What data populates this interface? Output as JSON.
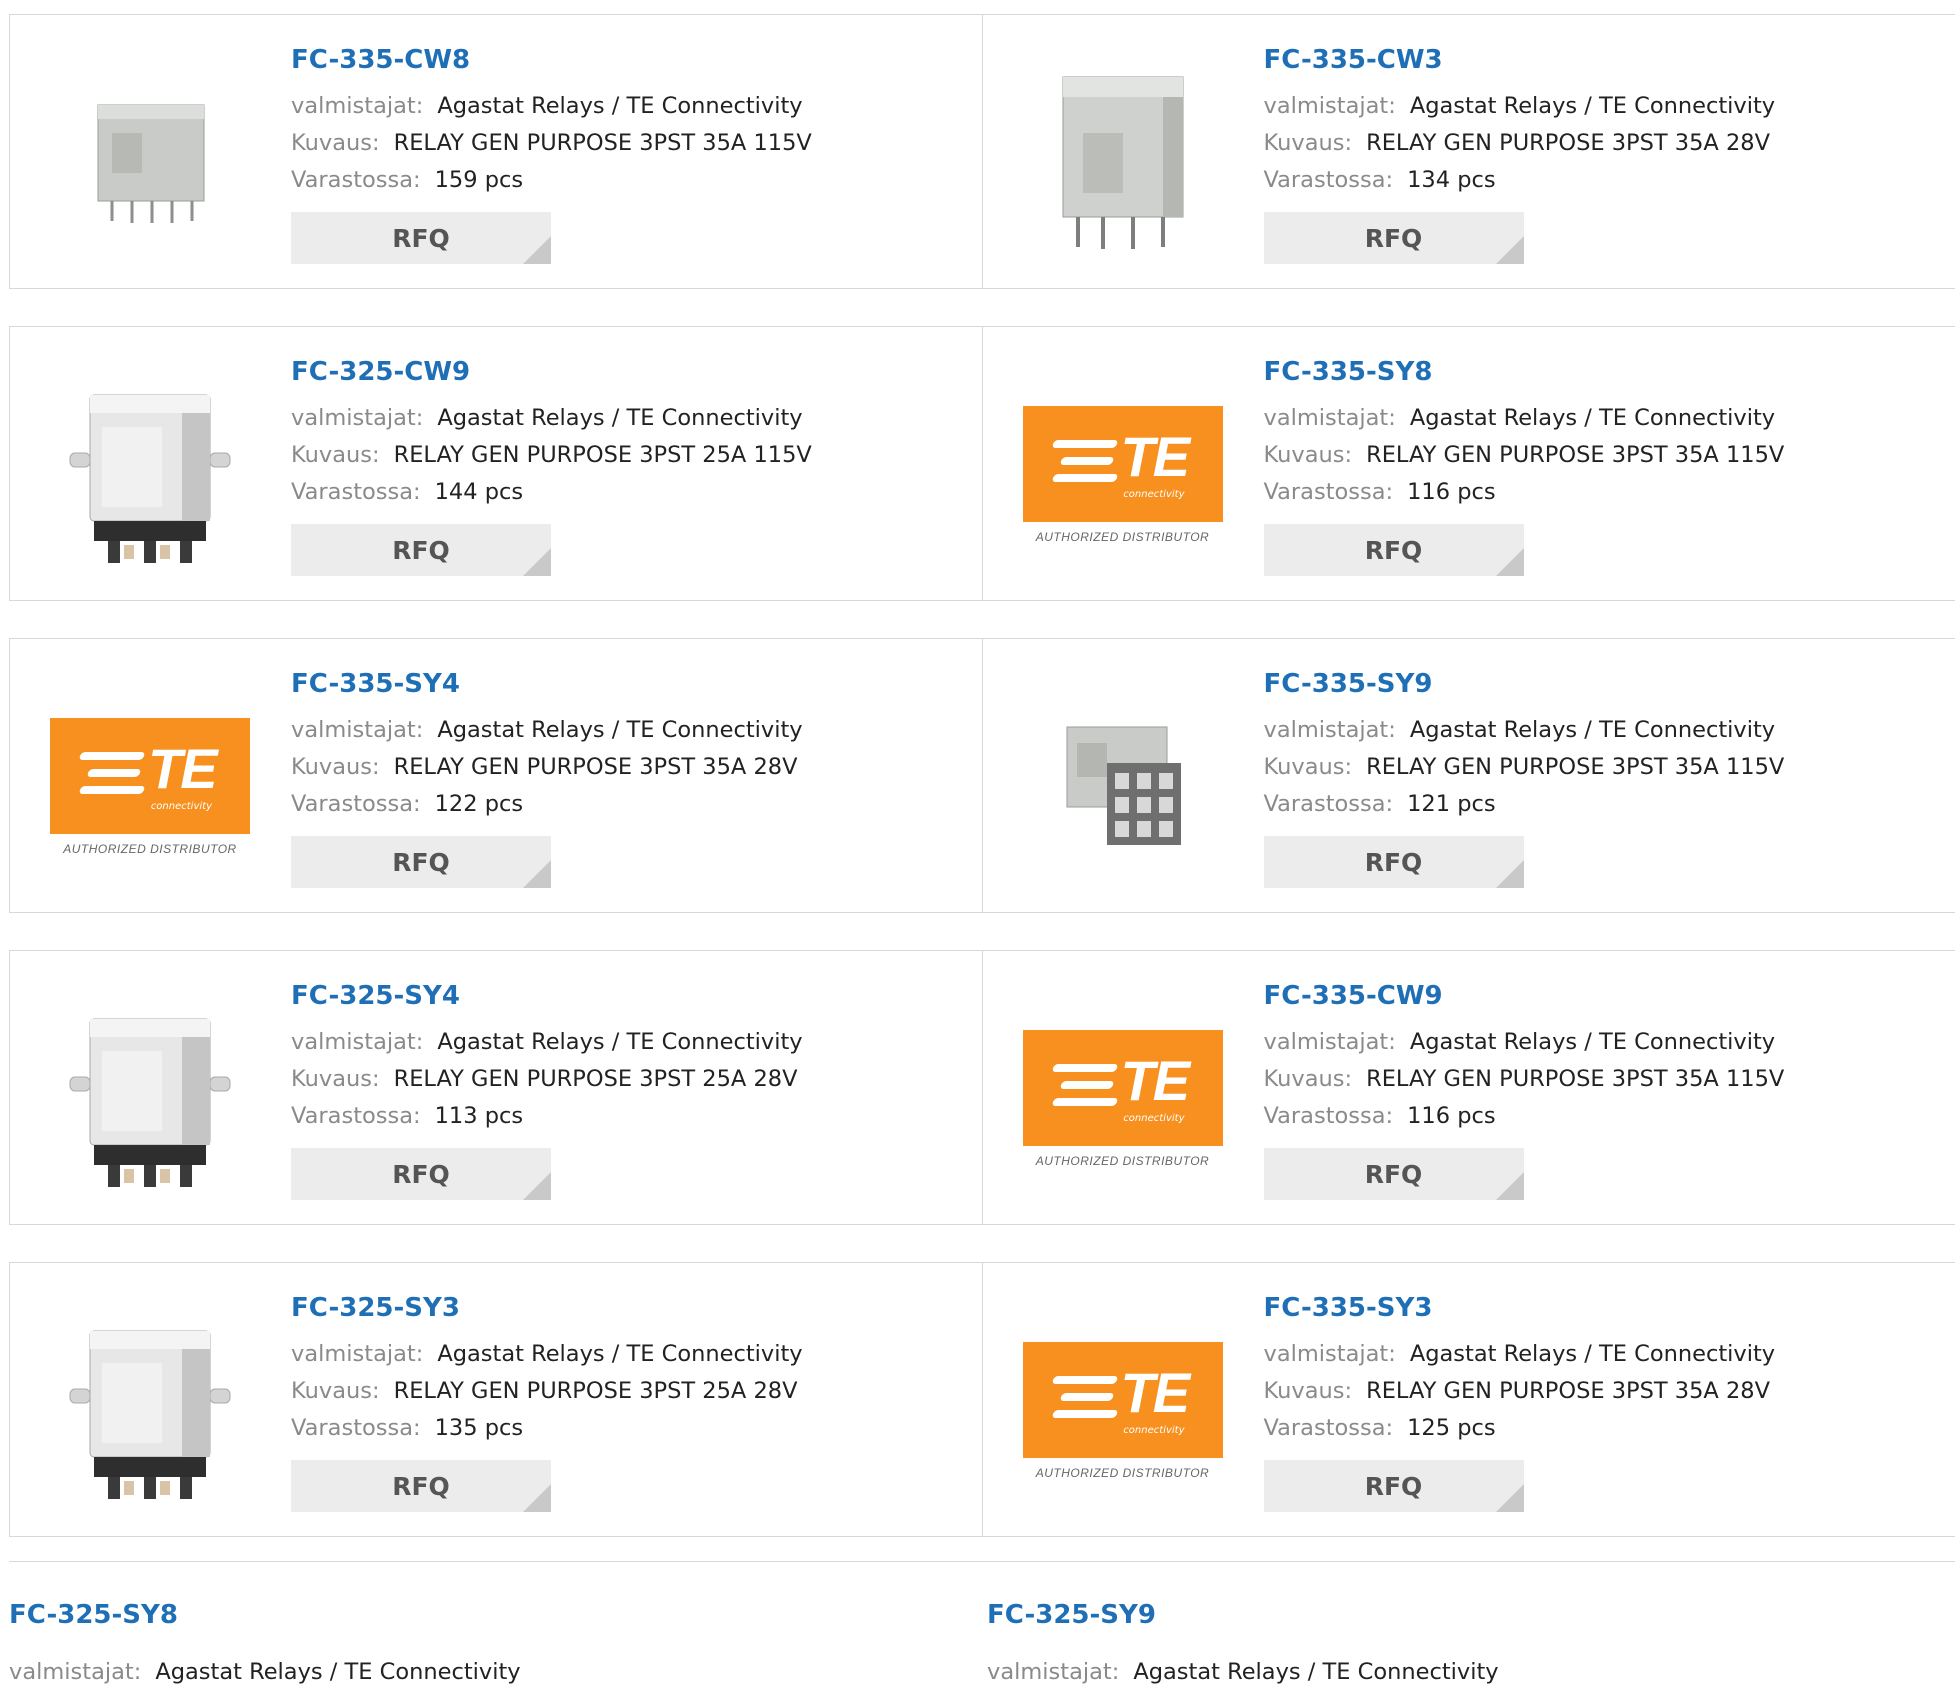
{
  "labels": {
    "manufacturer": "valmistajat:",
    "description": "Kuvaus:",
    "stock": "Varastossa:",
    "rfq": "RFQ"
  },
  "te_logo": {
    "brand": "TE",
    "sub": "connectivity",
    "authorized": "AUTHORIZED DISTRIBUTOR"
  },
  "colors": {
    "link": "#1f6fb6",
    "te_orange": "#f7901e",
    "rfq_bg": "#ececec"
  },
  "products": [
    {
      "part": "FC-335-CW8",
      "manufacturer": "Agastat Relays / TE Connectivity",
      "description": "RELAY GEN PURPOSE 3PST 35A 115V",
      "stock": "159 pcs",
      "image": "relay-small-icon"
    },
    {
      "part": "FC-335-CW3",
      "manufacturer": "Agastat Relays / TE Connectivity",
      "description": "RELAY GEN PURPOSE 3PST 35A 28V",
      "stock": "134 pcs",
      "image": "relay-tall-icon"
    },
    {
      "part": "FC-325-CW9",
      "manufacturer": "Agastat Relays / TE Connectivity",
      "description": "RELAY GEN PURPOSE 3PST 25A 115V",
      "stock": "144 pcs",
      "image": "relay-flange-icon"
    },
    {
      "part": "FC-335-SY8",
      "manufacturer": "Agastat Relays / TE Connectivity",
      "description": "RELAY GEN PURPOSE 3PST 35A 115V",
      "stock": "116 pcs",
      "image": "te-logo"
    },
    {
      "part": "FC-335-SY4",
      "manufacturer": "Agastat Relays / TE Connectivity",
      "description": "RELAY GEN PURPOSE 3PST 35A 28V",
      "stock": "122 pcs",
      "image": "te-logo"
    },
    {
      "part": "FC-335-SY9",
      "manufacturer": "Agastat Relays / TE Connectivity",
      "description": "RELAY GEN PURPOSE 3PST 35A 115V",
      "stock": "121 pcs",
      "image": "relay-socket-icon"
    },
    {
      "part": "FC-325-SY4",
      "manufacturer": "Agastat Relays / TE Connectivity",
      "description": "RELAY GEN PURPOSE 3PST 25A 28V",
      "stock": "113 pcs",
      "image": "relay-flange-icon"
    },
    {
      "part": "FC-335-CW9",
      "manufacturer": "Agastat Relays / TE Connectivity",
      "description": "RELAY GEN PURPOSE 3PST 35A 115V",
      "stock": "116 pcs",
      "image": "te-logo"
    },
    {
      "part": "FC-325-SY3",
      "manufacturer": "Agastat Relays / TE Connectivity",
      "description": "RELAY GEN PURPOSE 3PST 25A 28V",
      "stock": "135 pcs",
      "image": "relay-flange-icon"
    },
    {
      "part": "FC-335-SY3",
      "manufacturer": "Agastat Relays / TE Connectivity",
      "description": "RELAY GEN PURPOSE 3PST 35A 28V",
      "stock": "125 pcs",
      "image": "te-logo"
    }
  ],
  "partial_products": [
    {
      "part": "FC-325-SY8",
      "manufacturer": "Agastat Relays / TE Connectivity"
    },
    {
      "part": "FC-325-SY9",
      "manufacturer": "Agastat Relays / TE Connectivity"
    }
  ]
}
